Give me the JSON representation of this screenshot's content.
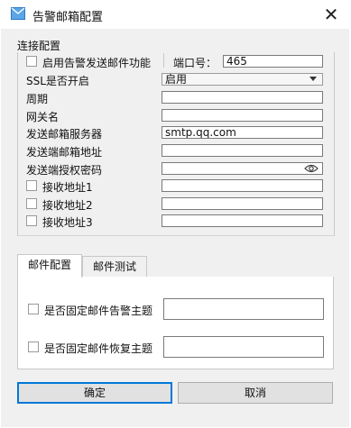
{
  "window": {
    "title": "告警邮箱配置",
    "close_glyph": "✕"
  },
  "connection": {
    "group_label": "连接配置",
    "enable_label": "启用告警发送邮件功能",
    "port_label": "端口号：",
    "port_value": "465",
    "ssl_label": "SSL是否开启",
    "ssl_value": "启用",
    "period_label": "周期",
    "gateway_label": "网关名",
    "server_label": "发送邮箱服务器",
    "server_value": "smtp.qq.com",
    "sender_label": "发送端邮箱地址",
    "auth_label": "发送端授权密码",
    "recv1_label": "接收地址1",
    "recv2_label": "接收地址2",
    "recv3_label": "接收地址3"
  },
  "tabs": [
    {
      "label": "邮件配置",
      "active": true
    },
    {
      "label": "邮件测试",
      "active": false
    }
  ],
  "mail_config": {
    "fixed_alarm_subject_label": "是否固定邮件告警主题",
    "fixed_recover_subject_label": "是否固定邮件恢复主题"
  },
  "buttons": {
    "ok": "确定",
    "cancel": "取消"
  },
  "icons": {
    "app": "mail-icon",
    "close": "close-icon",
    "eye": "eye-icon",
    "dropdown": "chevron-down-icon"
  }
}
